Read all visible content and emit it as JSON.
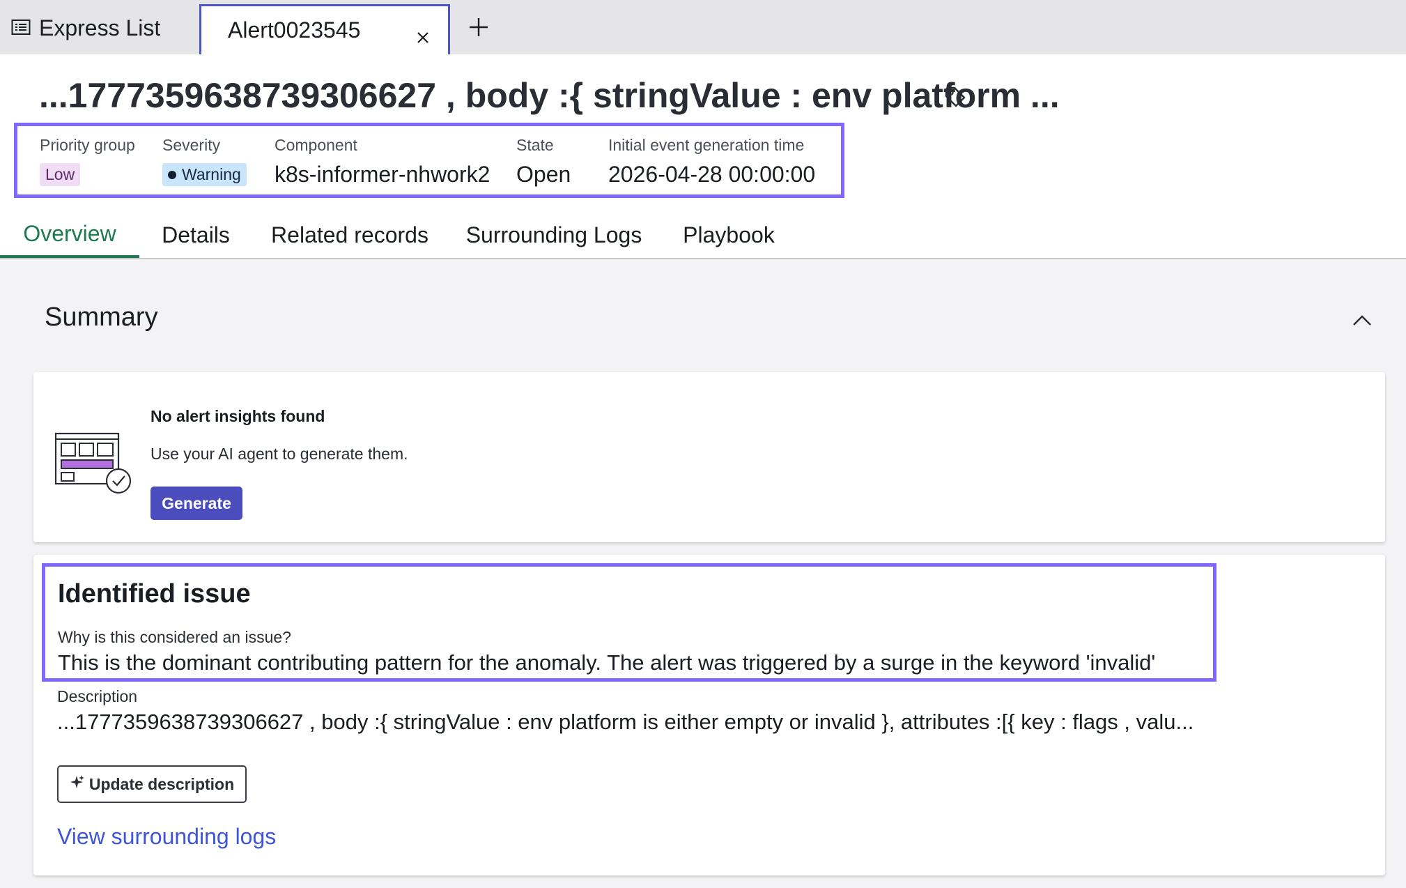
{
  "tabbar": {
    "express_list_label": "Express List",
    "active_tab_label": "Alert0023545"
  },
  "header": {
    "title": "...1777359638739306627 , body :{ stringValue : env platform ...",
    "meta": {
      "priority_group_label": "Priority group",
      "priority_group_value": "Low",
      "severity_label": "Severity",
      "severity_value": "Warning",
      "component_label": "Component",
      "component_value": "k8s-informer-nhwork2",
      "state_label": "State",
      "state_value": "Open",
      "initial_time_label": "Initial event generation time",
      "initial_time_value": "2026-04-28 00:00:00"
    },
    "tabs": [
      {
        "label": "Overview"
      },
      {
        "label": "Details"
      },
      {
        "label": "Related records"
      },
      {
        "label": "Surrounding Logs"
      },
      {
        "label": "Playbook"
      }
    ]
  },
  "summary": {
    "title": "Summary",
    "insights": {
      "title": "No alert insights found",
      "text": "Use your AI agent to generate them.",
      "generate_label": "Generate"
    },
    "issue": {
      "title": "Identified issue",
      "why_label": "Why is this considered an issue?",
      "why_text": "This is the dominant contributing pattern for the anomaly. The alert was triggered by a surge in the keyword 'invalid'",
      "description_label": "Description",
      "description_text": "...1777359638739306627 , body :{ stringValue : env platform is either empty or invalid }, attributes :[{ key : flags , valu...",
      "update_label": "Update description",
      "view_logs_label": "View surrounding logs"
    }
  },
  "colors": {
    "highlight": "#7f67ff",
    "active_tab": "#1b7a4f",
    "primary_button": "#4a4dbb",
    "link": "#3d55d6",
    "badge_low_bg": "#f0dcf5",
    "badge_warning_bg": "#c9e5fb"
  },
  "icons": [
    "list-icon",
    "close-icon",
    "plus-icon",
    "tag-icon",
    "chevron-up-icon",
    "insights-illustration",
    "sparkle-icon"
  ]
}
